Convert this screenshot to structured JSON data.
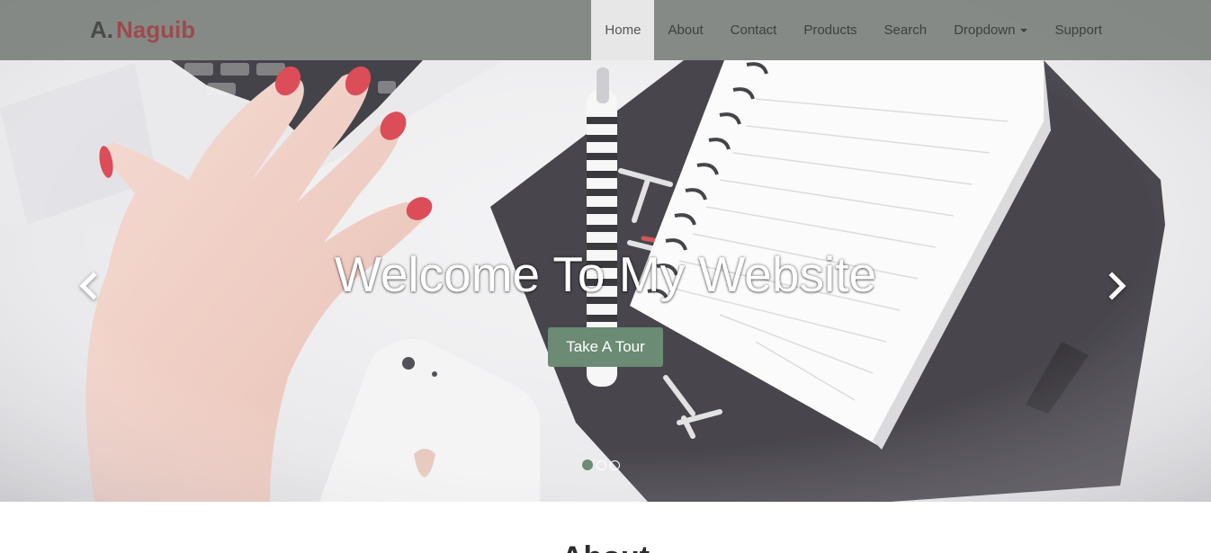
{
  "navbar": {
    "brand": {
      "initial": "A.",
      "name": "Naguib"
    },
    "items": [
      {
        "label": "Home",
        "active": true
      },
      {
        "label": "About"
      },
      {
        "label": "Contact"
      },
      {
        "label": "Products"
      },
      {
        "label": "Search"
      },
      {
        "label": "Dropdown",
        "has_caret": true
      },
      {
        "label": "Support"
      }
    ]
  },
  "hero": {
    "title": "Welcome To My Website",
    "button_label": "Take A Tour",
    "prev_icon": "chevron-left-icon",
    "next_icon": "chevron-right-icon",
    "slides": 3,
    "active_slide": 1,
    "photo": "hand-on-laptop-keyboard-with-notebook-pen-phone"
  },
  "about": {
    "title": "About"
  },
  "colors": {
    "navbar_bg": "#767c78",
    "brand_initial": "#4a4a4a",
    "brand_name": "#9c4a4e",
    "accent_green": "#6b8b74",
    "active_nav_bg": "#e7e7e7"
  }
}
